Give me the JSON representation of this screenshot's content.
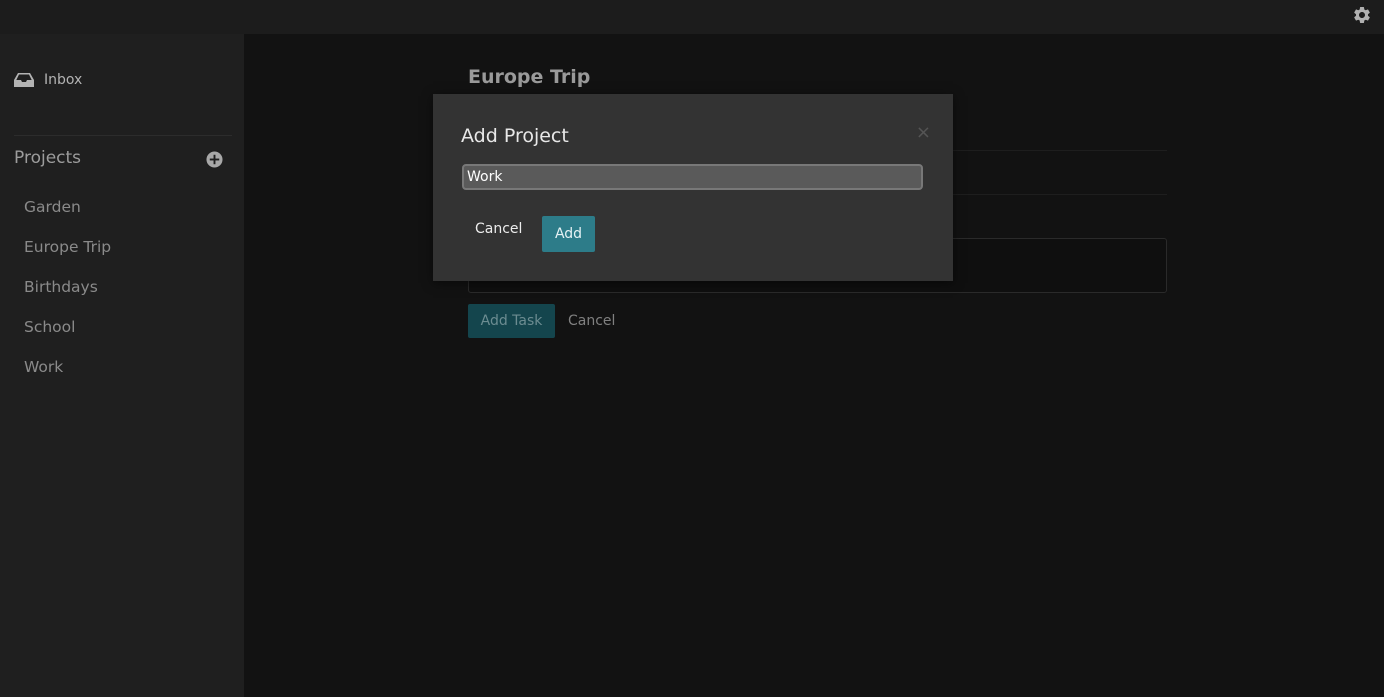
{
  "sidebar": {
    "inbox_label": "Inbox",
    "projects_header": "Projects",
    "projects": [
      {
        "label": "Garden"
      },
      {
        "label": "Europe Trip"
      },
      {
        "label": "Birthdays"
      },
      {
        "label": "School"
      },
      {
        "label": "Work"
      }
    ]
  },
  "main": {
    "title": "Europe Trip",
    "add_task_label": "Add Task",
    "cancel_label": "Cancel"
  },
  "modal": {
    "title": "Add Project",
    "close_glyph": "×",
    "input_value": "Work",
    "cancel_label": "Cancel",
    "add_label": "Add"
  },
  "colors": {
    "accent": "#2d7c89",
    "accent_dimmed": "#14454d"
  },
  "icons": [
    "gear-icon",
    "inbox-icon",
    "add-project-icon",
    "close-icon"
  ]
}
